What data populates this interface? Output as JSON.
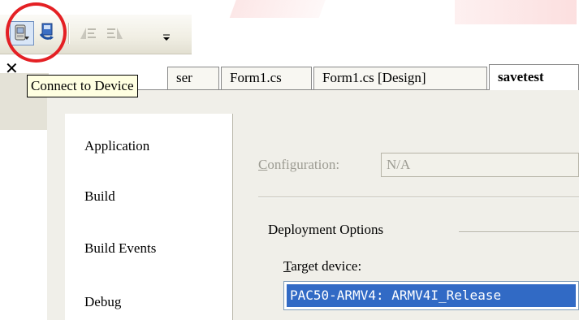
{
  "toolbar": {
    "buttons": [
      {
        "icon": "connect-device-icon"
      },
      {
        "icon": "device-options-icon"
      },
      {
        "icon": "align-left-icon"
      },
      {
        "icon": "align-right-icon"
      }
    ],
    "overflow_icon": "chevron-down-icon"
  },
  "tooltip": {
    "text": "Connect to Device"
  },
  "tabs": [
    {
      "label": "...owser",
      "visible_text": "ser"
    },
    {
      "label": "Form1.cs"
    },
    {
      "label": "Form1.cs [Design]"
    },
    {
      "label": "savetest",
      "active": true
    }
  ],
  "nav": {
    "items": [
      "Application",
      "Build",
      "Build Events",
      "Debug"
    ]
  },
  "configuration": {
    "label_prefix": "C",
    "label_rest": "onfiguration:",
    "value": "N/A"
  },
  "deployment": {
    "group_label": "Deployment Options",
    "target_label_prefix": "T",
    "target_label_rest": "arget device:",
    "target_value": "PAC50-ARMV4: ARMV4I_Release"
  },
  "colors": {
    "highlight": "#e42024",
    "selection": "#316ac5",
    "tooltip_bg": "#ffffe1"
  }
}
